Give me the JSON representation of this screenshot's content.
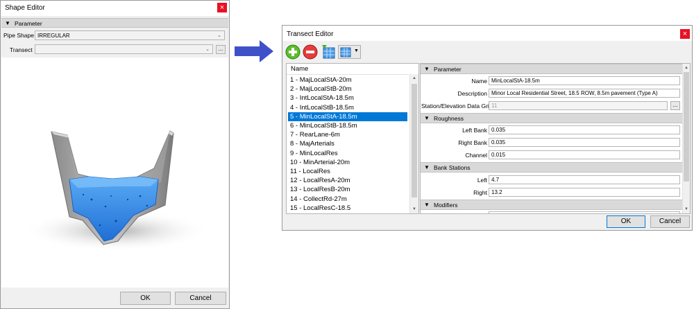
{
  "shape_editor": {
    "title": "Shape Editor",
    "close_glyph": "×",
    "section": "Parameter",
    "pipe_shape_label": "Pipe Shape",
    "pipe_shape_value": "IRREGULAR",
    "transect_label": "Transect",
    "transect_value": "",
    "browse_label": "...",
    "ok_label": "OK",
    "cancel_label": "Cancel"
  },
  "transect_editor": {
    "title": "Transect Editor",
    "close_glyph": "×",
    "toolbar": [
      "add-icon",
      "remove-icon",
      "import-grid-icon",
      "grid-options-icon"
    ],
    "list_header": "Name",
    "items": [
      "1 - MajLocalStA-20m",
      "2 - MajLocalStB-20m",
      "3 - IntLocalStA-18.5m",
      "4 - IntLocalStB-18.5m",
      "5 - MinLocalStA-18.5m",
      "6 - MinLocalStB-18.5m",
      "7 - RearLane-6m",
      "8 - MajArterials",
      "9 - MinLocalRes",
      "10 - MinArterial-20m",
      "11 - LocalRes",
      "12 - LocalResA-20m",
      "13 - LocalResB-20m",
      "14 - CollectRd-27m",
      "15 - LocalResC-18.5"
    ],
    "selected_index": 4,
    "sections": {
      "parameter": "Parameter",
      "roughness": "Roughness",
      "bank_stations": "Bank Stations",
      "modifiers": "Modifiers"
    },
    "fields": {
      "name_label": "Name",
      "name_value": "MinLocalStA-18.5m",
      "description_label": "Description",
      "description_value": "Minor Local Residential Street, 18.5 ROW, 8.5m pavement  (Type A)",
      "grid_label": "Station/Elevation Data Grid",
      "grid_value": "11",
      "grid_browse": "...",
      "left_bank_label": "Left Bank",
      "left_bank_value": "0.035",
      "right_bank_label": "Right Bank",
      "right_bank_value": "0.035",
      "channel_label": "Channel",
      "channel_value": "0.015",
      "left_label": "Left",
      "left_value": "4.7",
      "right_label": "Right",
      "right_value": "13.2"
    },
    "ok_label": "OK",
    "cancel_label": "Cancel"
  },
  "colors": {
    "selection": "#0078d7",
    "arrow": "#3f51c9",
    "water": "#2e8ff0",
    "close": "#e81123"
  }
}
